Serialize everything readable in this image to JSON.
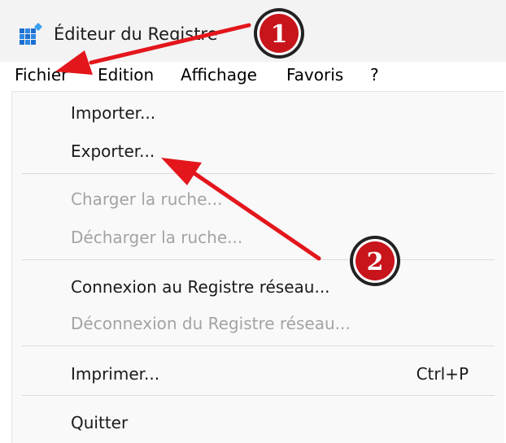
{
  "window": {
    "title": "Éditeur du Registre",
    "icon": "registry-editor-icon"
  },
  "menubar": {
    "items": [
      "Fichier",
      "Edition",
      "Affichage",
      "Favoris",
      "?"
    ]
  },
  "file_menu": {
    "items": [
      {
        "label": "Importer...",
        "enabled": true
      },
      {
        "label": "Exporter...",
        "enabled": true
      },
      {
        "label": "Charger la ruche...",
        "enabled": false
      },
      {
        "label": "Décharger la ruche...",
        "enabled": false
      },
      {
        "label": "Connexion au Registre réseau...",
        "enabled": true
      },
      {
        "label": "Déconnexion du Registre réseau...",
        "enabled": false
      },
      {
        "label": "Imprimer...",
        "enabled": true,
        "shortcut": "Ctrl+P"
      },
      {
        "label": "Quitter",
        "enabled": true
      }
    ]
  },
  "annotations": {
    "badges": [
      "1",
      "2"
    ],
    "arrow_color": "#e3161c",
    "badge_fill": "#c8141b"
  }
}
